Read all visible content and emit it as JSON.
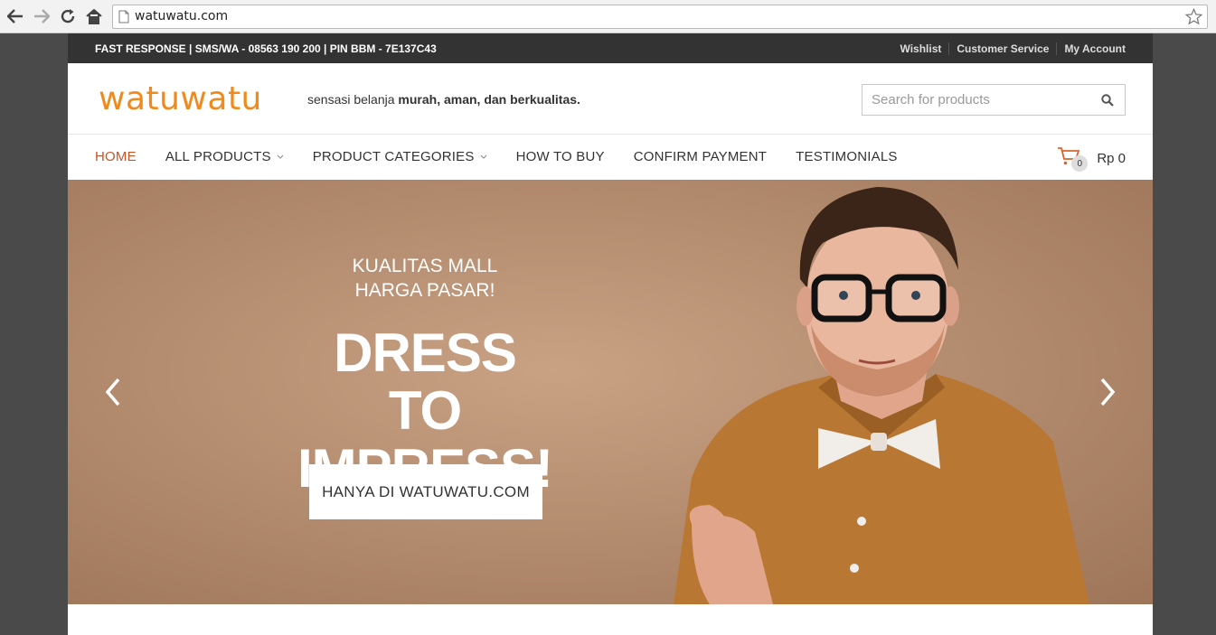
{
  "browser": {
    "url": "watuwatu.com"
  },
  "topbar": {
    "contact": "FAST RESPONSE | SMS/WA - 08563 190 200 | PIN BBM - 7E137C43",
    "links": [
      "Wishlist",
      "Customer Service",
      "My Account"
    ]
  },
  "header": {
    "logo": "watuwatu",
    "tagline_prefix": "sensasi belanja ",
    "tagline_bold": "murah, aman, dan berkualitas.",
    "search_placeholder": "Search for products"
  },
  "nav": {
    "items": [
      {
        "label": "HOME",
        "active": true
      },
      {
        "label": "ALL PRODUCTS",
        "dropdown": true
      },
      {
        "label": "PRODUCT CATEGORIES",
        "dropdown": true
      },
      {
        "label": "HOW TO BUY"
      },
      {
        "label": "CONFIRM PAYMENT"
      },
      {
        "label": "TESTIMONIALS"
      }
    ],
    "cart_count": "0",
    "cart_total": "Rp 0"
  },
  "hero": {
    "sub_line1": "KUALITAS MALL",
    "sub_line2": "HARGA PASAR!",
    "headline_line1": "DRESS TO",
    "headline_line2": "IMPRESS!",
    "cta": "HANYA DI WATUWATU.COM"
  },
  "colors": {
    "brand": "#f08a1c",
    "active_nav": "#c0562a",
    "topbar_bg": "#333333"
  }
}
